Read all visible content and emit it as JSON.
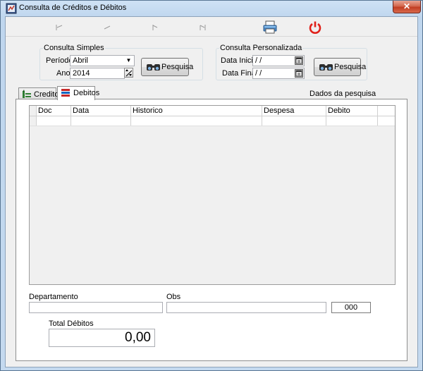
{
  "window": {
    "title": "Consulta de Créditos e Débitos",
    "close_glyph": "✕"
  },
  "toolbar": {
    "icons": [
      "first-record-icon",
      "previous-record-icon",
      "next-record-icon",
      "last-record-icon",
      "printer-icon",
      "power-icon"
    ],
    "power_color": "#e0211a"
  },
  "consulta_simples": {
    "legend": "Consulta Simples",
    "periodo_label": "Período",
    "periodo_value": "Abril",
    "ano_label": "Ano",
    "ano_value": "2014",
    "search_label": "Pesquisa"
  },
  "consulta_personalizada": {
    "legend": "Consulta Personalizada",
    "data_inicio_label": "Data Inicio",
    "data_inicio_value": "/ /",
    "data_final_label": "Data Final",
    "data_final_value": "/ /",
    "search_label": "Pesquisa"
  },
  "tabs": [
    {
      "label": "Creditos",
      "active": false
    },
    {
      "label": "Debitos",
      "active": true
    }
  ],
  "dados_label": "Dados da pesquisa",
  "grid": {
    "columns": [
      "Doc",
      "Data",
      "Historico",
      "Despesa",
      "Debito"
    ],
    "rows": [
      [
        "",
        "",
        "",
        "",
        ""
      ]
    ]
  },
  "footer": {
    "departamento_label": "Departamento",
    "departamento_value": "",
    "obs_label": "Obs",
    "obs_value": "",
    "count_value": "000",
    "total_label": "Total Débitos",
    "total_value": "0,00"
  }
}
